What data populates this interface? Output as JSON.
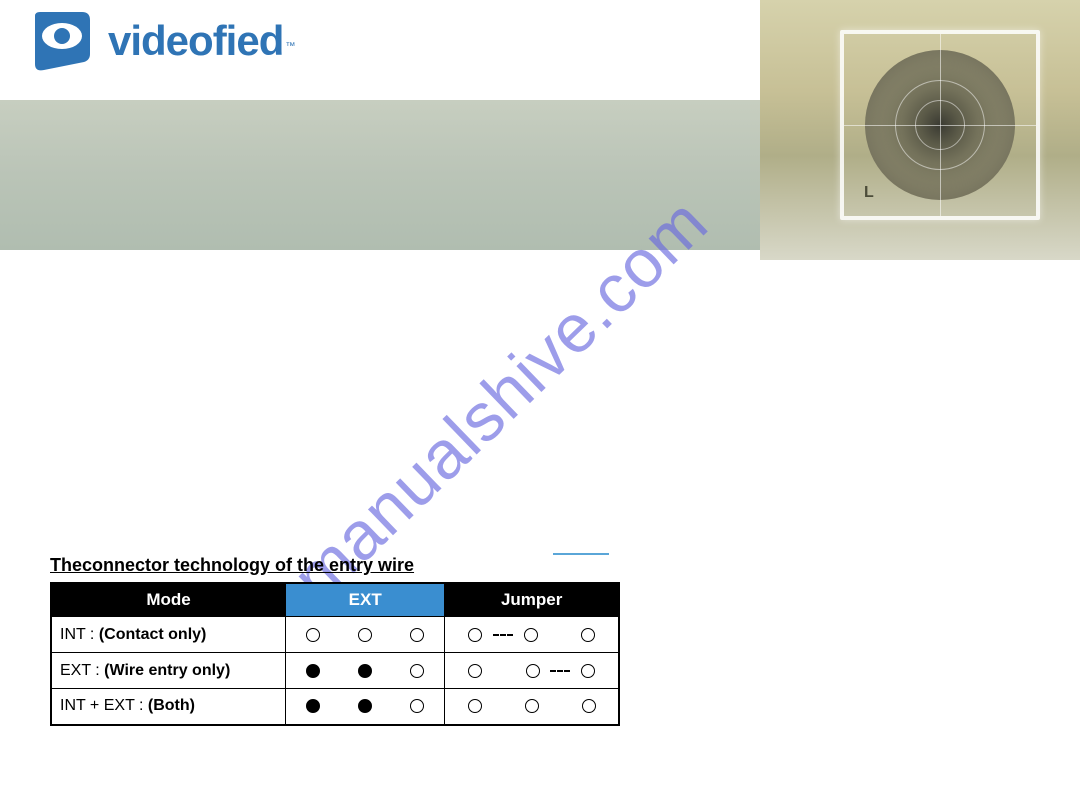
{
  "brand": {
    "name": "videofied",
    "tm": "™"
  },
  "eye_frame_label": "L",
  "watermark": "manualshive.com",
  "section_title": "Theconnector technology of the entry wire",
  "table": {
    "headers": {
      "mode": "Mode",
      "ext": "EXT",
      "jumper": "Jumper"
    },
    "rows": [
      {
        "label_prefix": "INT : ",
        "label_bold": "(Contact only)",
        "ext": [
          {
            "t": "pin",
            "f": false
          },
          {
            "t": "gap"
          },
          {
            "t": "pin",
            "f": false
          },
          {
            "t": "gap"
          },
          {
            "t": "pin",
            "f": false
          }
        ],
        "jumper": [
          {
            "t": "pin",
            "f": false
          },
          {
            "t": "link"
          },
          {
            "t": "pin",
            "f": false
          },
          {
            "t": "gap"
          },
          {
            "t": "pin",
            "f": false
          }
        ]
      },
      {
        "label_prefix": "EXT : ",
        "label_bold": "(Wire entry only)",
        "ext": [
          {
            "t": "pin",
            "f": true
          },
          {
            "t": "gap"
          },
          {
            "t": "pin",
            "f": true
          },
          {
            "t": "gap"
          },
          {
            "t": "pin",
            "f": false
          }
        ],
        "jumper": [
          {
            "t": "pin",
            "f": false
          },
          {
            "t": "gap"
          },
          {
            "t": "pin",
            "f": false
          },
          {
            "t": "link"
          },
          {
            "t": "pin",
            "f": false
          }
        ]
      },
      {
        "label_prefix": "INT + EXT : ",
        "label_bold": "(Both)",
        "ext": [
          {
            "t": "pin",
            "f": true
          },
          {
            "t": "gap"
          },
          {
            "t": "pin",
            "f": true
          },
          {
            "t": "gap"
          },
          {
            "t": "pin",
            "f": false
          }
        ],
        "jumper": [
          {
            "t": "pin",
            "f": false
          },
          {
            "t": "gap"
          },
          {
            "t": "pin",
            "f": false
          },
          {
            "t": "gap"
          },
          {
            "t": "pin",
            "f": false
          }
        ]
      }
    ]
  }
}
